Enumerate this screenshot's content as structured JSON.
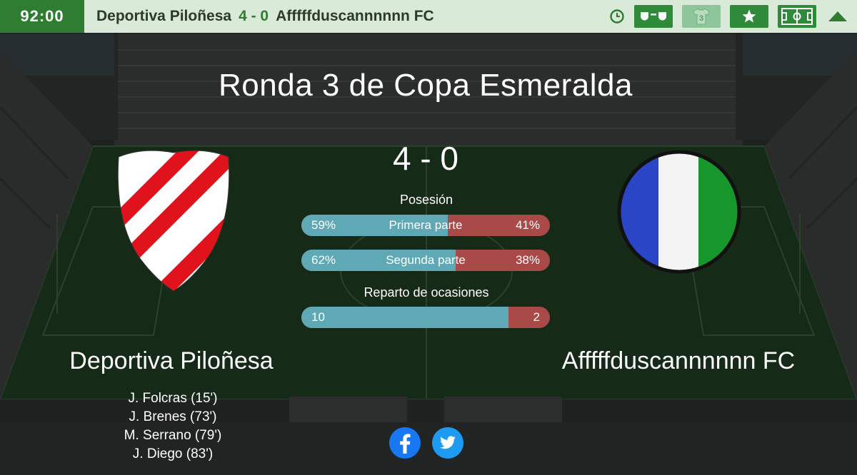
{
  "topbar": {
    "clock": "92:00",
    "home_team": "Deportiva Piloñesa",
    "score": "4 - 0",
    "away_team": "Afffffduscannnnnn FC",
    "shirt_number": "3",
    "icons": [
      "clock-icon",
      "lineup-icon",
      "shirt-icon",
      "star-icon",
      "pitch-icon",
      "collapse-icon"
    ]
  },
  "match": {
    "title": "Ronda 3 de Copa Esmeralda",
    "score": "4 - 0"
  },
  "stats": {
    "possession_label": "Posesión",
    "first_half": {
      "label": "Primera parte",
      "home": "59%",
      "away": "41%",
      "home_pct": 59
    },
    "second_half": {
      "label": "Segunda parte",
      "home": "62%",
      "away": "38%",
      "home_pct": 62
    },
    "chances_label": "Reparto de ocasiones",
    "chances": {
      "home": "10",
      "away": "2",
      "home_value": 10,
      "away_value": 2
    }
  },
  "home": {
    "name": "Deportiva Piloñesa",
    "scorers": [
      "J. Folcras (15')",
      "J. Brenes (73')",
      "M. Serrano (79')",
      "J. Diego (83')"
    ]
  },
  "away": {
    "name": "Afffffduscannnnnn FC"
  },
  "social": [
    "facebook-icon",
    "twitter-icon"
  ],
  "colors": {
    "accent_green": "#2e7d32",
    "topbar_bg": "#d9ead9",
    "home_bar": "#5fa8b6",
    "away_bar": "#a94a48"
  }
}
